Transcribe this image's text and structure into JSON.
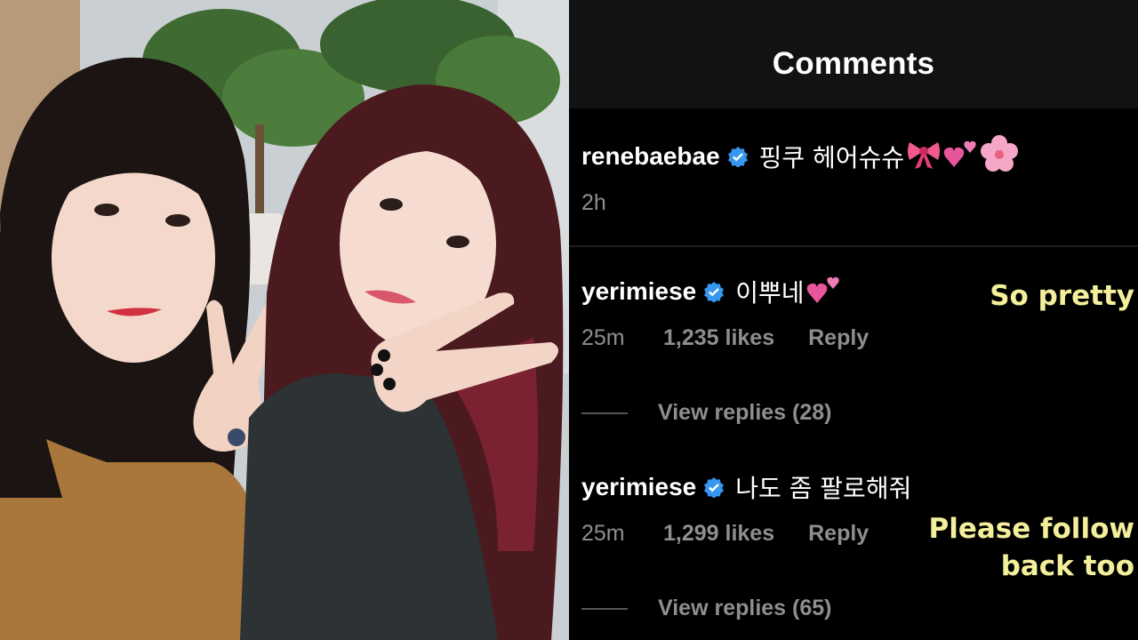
{
  "header": {
    "title": "Comments"
  },
  "comments": [
    {
      "username": "renebaebae",
      "verified": true,
      "text": "핑쿠 헤어슈슈",
      "emojis": [
        "ribbon-emoji",
        "two-hearts-emoji",
        "cherry-blossom-emoji"
      ],
      "time": "2h"
    },
    {
      "username": "yerimiese",
      "verified": true,
      "text": "이뿌네",
      "emojis": [
        "two-hearts-emoji"
      ],
      "time": "25m",
      "likes": "1,235 likes",
      "reply_label": "Reply",
      "view_replies": "View replies (28)",
      "translation": "So pretty"
    },
    {
      "username": "yerimiese",
      "verified": true,
      "text": "나도 좀 팔로해줘",
      "emojis": [],
      "time": "25m",
      "likes": "1,299 likes",
      "reply_label": "Reply",
      "view_replies": "View replies (65)",
      "translation_line1": "Please follow",
      "translation_line2": "back too"
    }
  ],
  "colors": {
    "background": "#000000",
    "header_bg": "#121212",
    "muted_text": "#8e8e8e",
    "verified_blue": "#3797f0",
    "translation_yellow": "#f4ef9b"
  }
}
